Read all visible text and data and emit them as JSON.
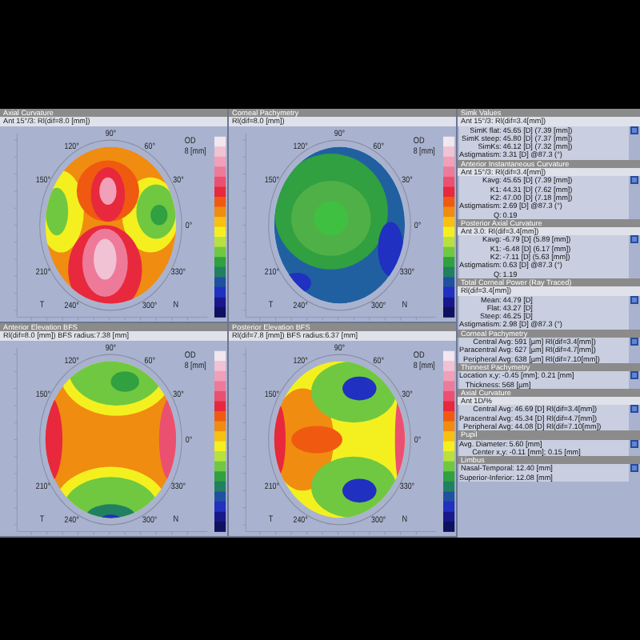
{
  "maps": [
    {
      "title": "Axial Curvature",
      "subtitle": "Ant 15°/3: Rl(dif=8.0 [mm])",
      "kind": "axial",
      "eye": "OD",
      "scale": "8 [mm]",
      "temporal": "T",
      "nasal": "N",
      "angles": [
        "90°",
        "120°",
        "60°",
        "150°",
        "30°",
        "0°",
        "210°",
        "330°",
        "240°",
        "300°"
      ]
    },
    {
      "title": "Corneal Pachymetry",
      "subtitle": "Rl(dif=8.0 [mm])",
      "kind": "pachymetry",
      "eye": "OD",
      "scale": "8 [mm]",
      "temporal": "T",
      "nasal": "N",
      "angles": [
        "90°",
        "120°",
        "60°",
        "150°",
        "30°",
        "0°",
        "210°",
        "330°",
        "240°",
        "300°"
      ]
    },
    {
      "title": "Anterior Elevation BFS",
      "subtitle": "Rl(dif=8.0 [mm]) BFS radius:7.38 [mm]",
      "kind": "anterior",
      "eye": "OD",
      "scale": "8 [mm]",
      "temporal": "T",
      "nasal": "N",
      "angles": [
        "90°",
        "120°",
        "60°",
        "150°",
        "30°",
        "0°",
        "210°",
        "330°",
        "240°",
        "300°"
      ]
    },
    {
      "title": "Posterior Elevation BFS",
      "subtitle": "Rl(dif=7.8 [mm]) BFS radius:6.37 [mm]",
      "kind": "posterior",
      "eye": "OD",
      "scale": "8 [mm]",
      "temporal": "T",
      "nasal": "N",
      "angles": [
        "90°",
        "120°",
        "60°",
        "150°",
        "30°",
        "0°",
        "210°",
        "330°",
        "240°",
        "300°"
      ]
    }
  ],
  "sections": [
    {
      "title": "Simk Values",
      "subtitle": "Ant 15°/3: Rl(dif=3.4[mm])",
      "rows": [
        {
          "label": "SimK flat:",
          "value": "45.65 [D] (7.39 [mm])"
        },
        {
          "label": "SimK steep:",
          "value": "45.80 [D] (7.37 [mm])"
        },
        {
          "label": "SimKs:",
          "value": "46.12 [D] (7.32 [mm])"
        },
        {
          "label": "Astigmatism:",
          "value": "3.31 [D] @87.3 (°)"
        }
      ]
    },
    {
      "title": "Anterior Instantaneous Curvature",
      "subtitle": "Ant 15°/3: Rl(dif=3.4[mm])",
      "rows": [
        {
          "label": "Kavg:",
          "value": "45.65 [D] (7.39 [mm])"
        },
        {
          "label": "K1:",
          "value": "44.31 [D] (7.62 [mm])"
        },
        {
          "label": "K2:",
          "value": "47.00 [D] (7.18 [mm])"
        },
        {
          "label": "Astigmatism:",
          "value": "2.69 [D] @87.3 (°)"
        },
        {
          "label": "Q:",
          "value": "0.19"
        }
      ]
    },
    {
      "title": "Posterior Axial Curvature",
      "subtitle": "Ant 3.0: Rl(dif=3.4[mm])",
      "rows": [
        {
          "label": "Kavg:",
          "value": "-6.79 [D] (5.89 [mm])"
        },
        {
          "label": "K1:",
          "value": "-6.48 [D] (6.17 [mm])"
        },
        {
          "label": "K2:",
          "value": "-7.11 [D] (5.63 [mm])"
        },
        {
          "label": "Astigmatism:",
          "value": "0.63 [D] @87.3 (°)"
        },
        {
          "label": "Q:",
          "value": "1.19"
        }
      ]
    },
    {
      "title": "Total Corneal Power (Ray Traced)",
      "subtitle": "Rl(dif=3.4[mm])",
      "rows": [
        {
          "label": "Mean:",
          "value": "44.79 [D]"
        },
        {
          "label": "Flat:",
          "value": "43.27 [D]"
        },
        {
          "label": "Steep:",
          "value": "46.25 [D]"
        },
        {
          "label": "Astigmatism:",
          "value": "2.98 [D] @87.3 (°)"
        }
      ]
    },
    {
      "title": "Corneal Pachymetry",
      "rows": [
        {
          "label": "Central Avg:",
          "value": "591 [µm] Rl(dif=3.4[mm])"
        },
        {
          "label": "Paracentral Avg:",
          "value": "627 [µm] Rl(dif=4.7[mm])"
        },
        {
          "label": "Peripheral Avg:",
          "value": "638 [µm] Rl(dif=7.10[mm])"
        }
      ]
    },
    {
      "title": "Thinnest Pachymetry",
      "rows": [
        {
          "label": "Location x,y:",
          "value": "-0.45 [mm]; 0.21 [mm]"
        },
        {
          "label": "Thickness:",
          "value": "568 [µm]"
        }
      ]
    },
    {
      "title": "Axial Curvature",
      "subtitle": "Ant 1D/%",
      "rows": [
        {
          "label": "Central Avg:",
          "value": "46.69 [D] Rl(dif=3.4[mm])"
        },
        {
          "label": "Paracentral Avg:",
          "value": "45.34 [D] Rl(dif=4.7[mm])"
        },
        {
          "label": "Peripheral Avg:",
          "value": "44.08 [D] Rl(dif=7.10[mm])"
        }
      ]
    },
    {
      "title": "Pupil",
      "rows": [
        {
          "label": "Avg. Diameter:",
          "value": "5.60 [mm]"
        },
        {
          "label": "Center x,y:",
          "value": "-0.11 [mm]; 0.15 [mm]"
        }
      ]
    },
    {
      "title": "Limbus",
      "rows": [
        {
          "label": "Nasal-Temporal:",
          "value": "12.40 [mm]"
        },
        {
          "label": "Superior-Inferior:",
          "value": "12.08 [mm]"
        }
      ]
    }
  ]
}
